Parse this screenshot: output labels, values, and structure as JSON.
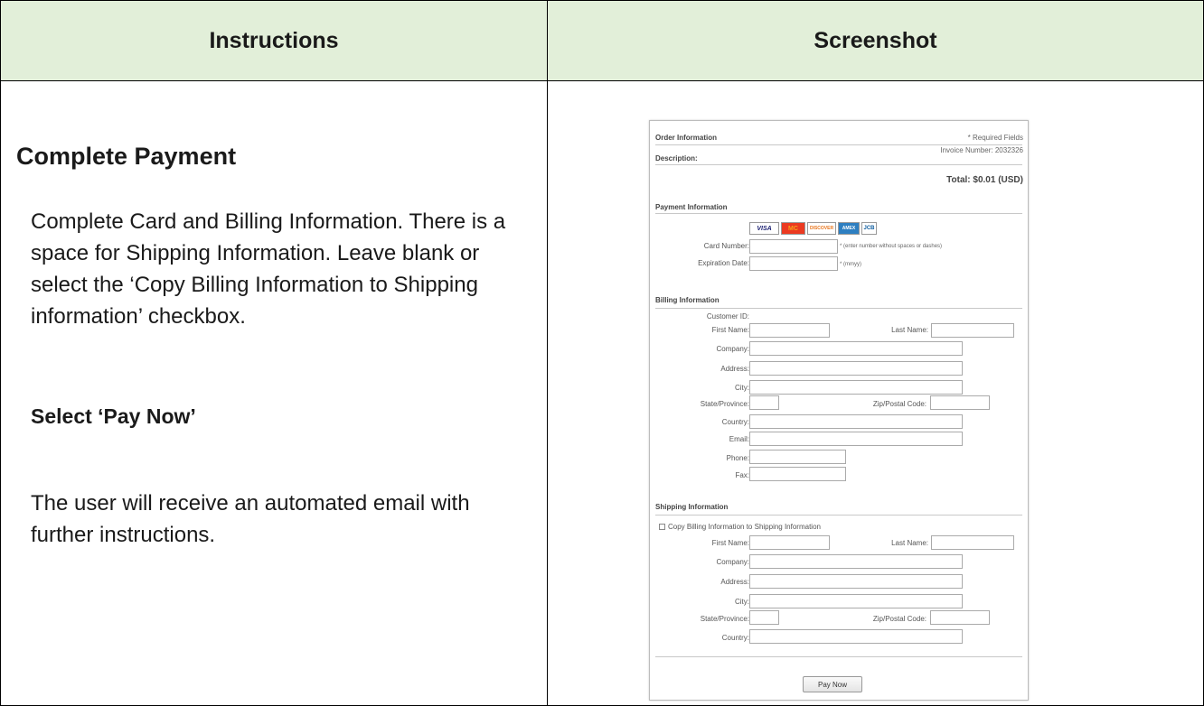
{
  "table": {
    "header_left": "Instructions",
    "header_right": "Screenshot"
  },
  "instructions": {
    "title": "Complete Payment",
    "body": "Complete Card and Billing Information. There is a space for Shipping Information. Leave blank or select the ‘Copy Billing Information to Shipping information’ checkbox.",
    "subtitle": "Select ‘Pay Now’",
    "note": "The user will receive an automated email with further instructions."
  },
  "form": {
    "order_info": "Order Information",
    "required": "* Required Fields",
    "invoice": "Invoice Number: 2032326",
    "description": "Description:",
    "total": "Total:  $0.01 (USD)",
    "payment_info": "Payment Information",
    "cards": [
      "VISA",
      "MC",
      "DISCOVER",
      "AMEX",
      "JCB"
    ],
    "card_number_label": "Card Number:",
    "card_number_hint": "* (enter number without spaces or dashes)",
    "exp_label": "Expiration Date:",
    "exp_hint": "* (mmyy)",
    "billing_info": "Billing Information",
    "billing": {
      "customer_id": "Customer ID:",
      "first_name": "First Name:",
      "last_name": "Last Name:",
      "company": "Company:",
      "address": "Address:",
      "city": "City:",
      "state": "State/Province:",
      "zip": "Zip/Postal Code:",
      "country": "Country:",
      "email": "Email:",
      "phone": "Phone:",
      "fax": "Fax:"
    },
    "shipping_info": "Shipping Information",
    "copy_billing": "Copy Billing Information to Shipping Information",
    "shipping": {
      "first_name": "First Name:",
      "last_name": "Last Name:",
      "company": "Company:",
      "address": "Address:",
      "city": "City:",
      "state": "State/Province:",
      "zip": "Zip/Postal Code:",
      "country": "Country:"
    },
    "pay_now": "Pay Now"
  }
}
